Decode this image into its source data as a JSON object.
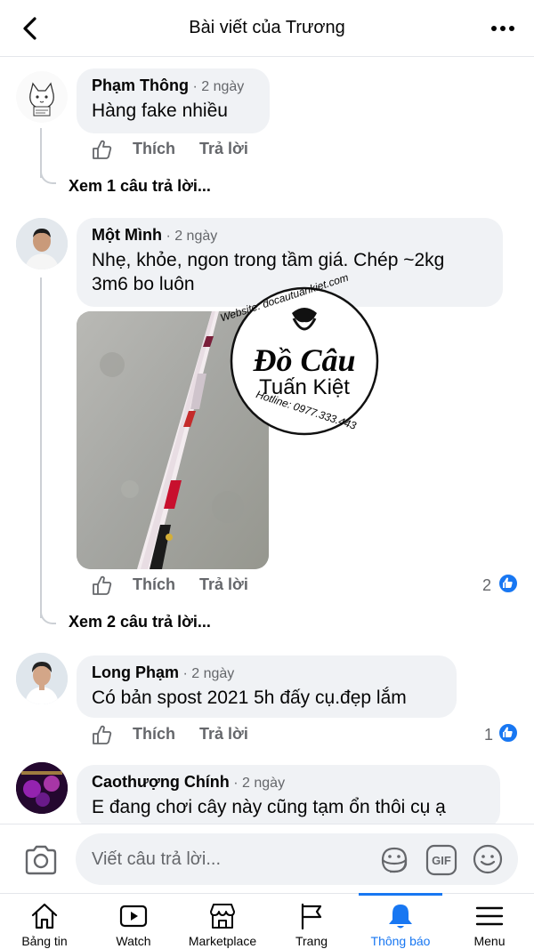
{
  "header": {
    "title": "Bài viết của Trương"
  },
  "comments": [
    {
      "author": "Phạm Thông",
      "time": "· 2 ngày",
      "text": "Hàng fake nhiều",
      "like": "Thích",
      "reply": "Trả lời",
      "view_replies": "Xem 1 câu trả lời..."
    },
    {
      "author": "Một Mình",
      "time": "· 2 ngày",
      "text_line1": "Nhẹ, khỏe, ngon trong tầm giá. Chép ~2kg",
      "text_line2": "3m6 bo luôn",
      "like": "Thích",
      "reply": "Trả lời",
      "reaction_count": "2",
      "view_replies": "Xem 2 câu trả lời...",
      "watermark": {
        "website": "Website: docautuankiet.com",
        "brand_line1": "Đồ Câu",
        "brand_line2": "Tuấn Kiệt",
        "hotline": "Hotline: 0977.333.443"
      }
    },
    {
      "author": "Long Phạm",
      "time": "· 2 ngày",
      "text": "Có bản spost 2021 5h đấy cụ.đẹp lắm",
      "like": "Thích",
      "reply": "Trả lời",
      "reaction_count": "1"
    },
    {
      "author": "Caothượng Chính",
      "time": "· 2 ngày",
      "text": "E đang chơi cây này cũng tạm ổn thôi cụ ạ"
    }
  ],
  "composer": {
    "placeholder": "Viết câu trả lời..."
  },
  "tabs": [
    {
      "label": "Bảng tin",
      "icon": "home-icon"
    },
    {
      "label": "Watch",
      "icon": "watch-icon"
    },
    {
      "label": "Marketplace",
      "icon": "marketplace-icon"
    },
    {
      "label": "Trang",
      "icon": "flag-icon"
    },
    {
      "label": "Thông báo",
      "icon": "bell-icon",
      "active": true
    },
    {
      "label": "Menu",
      "icon": "menu-icon"
    }
  ],
  "colors": {
    "accent": "#1877f2",
    "bubble": "#f0f2f5",
    "secondary_text": "#65676b"
  }
}
